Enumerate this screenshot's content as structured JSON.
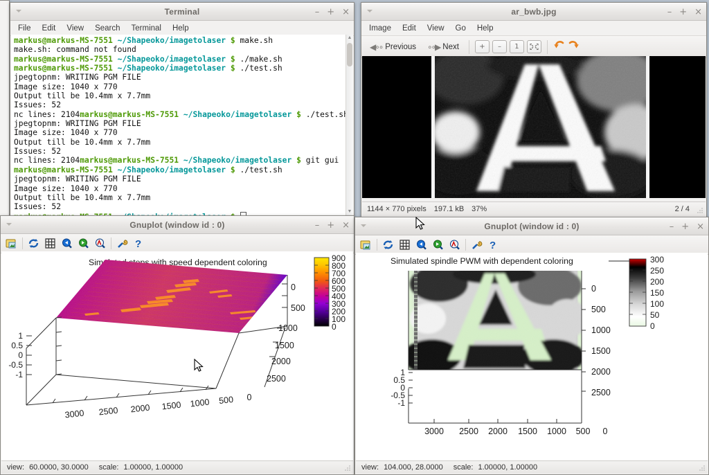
{
  "desktop": {
    "background_color": "#b9c4d0"
  },
  "terminal": {
    "title": "Terminal",
    "menus": [
      "File",
      "Edit",
      "View",
      "Search",
      "Terminal",
      "Help"
    ],
    "prompt_user": "markus@markus-MS-7551",
    "prompt_path": "~/Shapeoko/imagetolaser",
    "prompt_sign": "$",
    "lines": [
      {
        "type": "prompt",
        "command": "make.sh"
      },
      {
        "type": "out",
        "text": "make.sh: command not found"
      },
      {
        "type": "prompt",
        "command": "./make.sh"
      },
      {
        "type": "prompt",
        "command": "./test.sh"
      },
      {
        "type": "out",
        "text": "jpegtopnm: WRITING PGM FILE"
      },
      {
        "type": "out",
        "text": "Image size: 1040 x 770"
      },
      {
        "type": "out",
        "text": "Output till be 10.4mm x 7.7mm"
      },
      {
        "type": "out",
        "text": "Issues: 52"
      },
      {
        "type": "prompt_inline",
        "prefix": "nc lines: 2104",
        "command": "./test.sh"
      },
      {
        "type": "out",
        "text": "jpegtopnm: WRITING PGM FILE"
      },
      {
        "type": "out",
        "text": "Image size: 1040 x 770"
      },
      {
        "type": "out",
        "text": "Output till be 10.4mm x 7.7mm"
      },
      {
        "type": "out",
        "text": "Issues: 52"
      },
      {
        "type": "prompt_inline",
        "prefix": "nc lines: 2104",
        "command": "git gui"
      },
      {
        "type": "prompt",
        "command": "./test.sh"
      },
      {
        "type": "out",
        "text": "jpegtopnm: WRITING PGM FILE"
      },
      {
        "type": "out",
        "text": "Image size: 1040 x 770"
      },
      {
        "type": "out",
        "text": "Output till be 10.4mm x 7.7mm"
      },
      {
        "type": "out",
        "text": "Issues: 52"
      },
      {
        "type": "prompt_cursor",
        "command": ""
      }
    ],
    "window_buttons": {
      "minimize": "–",
      "maximize": "+",
      "close": "×"
    }
  },
  "viewer": {
    "title": "ar_bwb.jpg",
    "menus": [
      "Image",
      "Edit",
      "View",
      "Go",
      "Help"
    ],
    "toolbar": {
      "previous": "Previous",
      "next": "Next",
      "zoom_in": "+",
      "zoom_out": "–",
      "normal_size": "1",
      "best_fit": "⬚",
      "rotate_ccw": "↶",
      "rotate_cw": "↷"
    },
    "status": {
      "dimensions": "1144 × 770 pixels",
      "filesize": "197.1 kB",
      "zoom": "37%",
      "position": "2 / 4"
    },
    "window_buttons": {
      "minimize": "–",
      "maximize": "+",
      "close": "×"
    }
  },
  "gnuplot1": {
    "title": "Gnuplot (window id : 0)",
    "status_view_label": "view:",
    "status_view_value": "60.0000, 30.0000",
    "status_scale_label": "scale:",
    "status_scale_value": "1.00000, 1.00000",
    "window_buttons": {
      "minimize": "–",
      "maximize": "+",
      "close": "×"
    },
    "toolbar_icons": [
      "export-icon",
      "replot-icon",
      "grid-icon",
      "previous-zoom-icon",
      "next-zoom-icon",
      "autoscale-icon",
      "settings-icon",
      "help-icon"
    ]
  },
  "gnuplot2": {
    "title": "Gnuplot (window id : 0)",
    "status_view_label": "view:",
    "status_view_value": "104.000, 28.0000",
    "status_scale_label": "scale:",
    "status_scale_value": "1.00000, 1.00000",
    "window_buttons": {
      "minimize": "–",
      "maximize": "+",
      "close": "×"
    },
    "toolbar_icons": [
      "export-icon",
      "replot-icon",
      "grid-icon",
      "previous-zoom-icon",
      "next-zoom-icon",
      "autoscale-icon",
      "settings-icon",
      "help-icon"
    ]
  },
  "chart_data": [
    {
      "id": "simulated-steps",
      "type": "heatmap",
      "projection": "3d-surface-pm3d",
      "title": "Simulated steps with speed dependent coloring",
      "legend_position": "top",
      "xlabel": "",
      "ylabel": "",
      "zlabel": "",
      "xticks": [
        3000,
        2500,
        2000,
        1500,
        1000,
        500,
        0
      ],
      "xlim": [
        3000,
        0
      ],
      "yticks": [
        0,
        500,
        1000,
        1500,
        2000,
        2500
      ],
      "ylim": [
        0,
        2500
      ],
      "zticks": [
        1,
        0.5,
        0,
        -0.5,
        -1
      ],
      "zlim": [
        -1,
        1
      ],
      "colorbar": {
        "ticks": [
          900,
          800,
          700,
          600,
          500,
          400,
          300,
          200,
          100,
          0
        ],
        "range": [
          0,
          900
        ],
        "palette": [
          "#000000",
          "#2b0050",
          "#5800a0",
          "#9400d3",
          "#c40099",
          "#e0265a",
          "#f25a10",
          "#ff9000",
          "#ffc400",
          "#ffe800"
        ]
      },
      "view": [
        60.0,
        30.0
      ],
      "scale": [
        1.0,
        1.0
      ],
      "grid": false
    },
    {
      "id": "simulated-spindle-pwm",
      "type": "heatmap",
      "projection": "3d-surface-pm3d",
      "title": "Simulated spindle PWM with dependent coloring",
      "legend_position": "top",
      "xlabel": "",
      "ylabel": "",
      "zlabel": "",
      "xticks": [
        3000,
        2500,
        2000,
        1500,
        1000,
        500,
        0
      ],
      "xlim": [
        3000,
        0
      ],
      "yticks": [
        0,
        500,
        1000,
        1500,
        2000,
        2500
      ],
      "ylim": [
        0,
        2500
      ],
      "zticks": [
        1,
        0.5,
        0,
        -0.5,
        -1
      ],
      "zlim": [
        -1,
        1
      ],
      "colorbar": {
        "ticks": [
          300,
          250,
          200,
          150,
          100,
          50,
          0
        ],
        "range": [
          0,
          300
        ],
        "palette": [
          "#e8f7e0",
          "#ffffff",
          "#d0d0d0",
          "#909090",
          "#404040",
          "#000000",
          "#cc0000"
        ]
      },
      "view": [
        104.0,
        28.0
      ],
      "scale": [
        1.0,
        1.0
      ],
      "grid": false
    }
  ]
}
